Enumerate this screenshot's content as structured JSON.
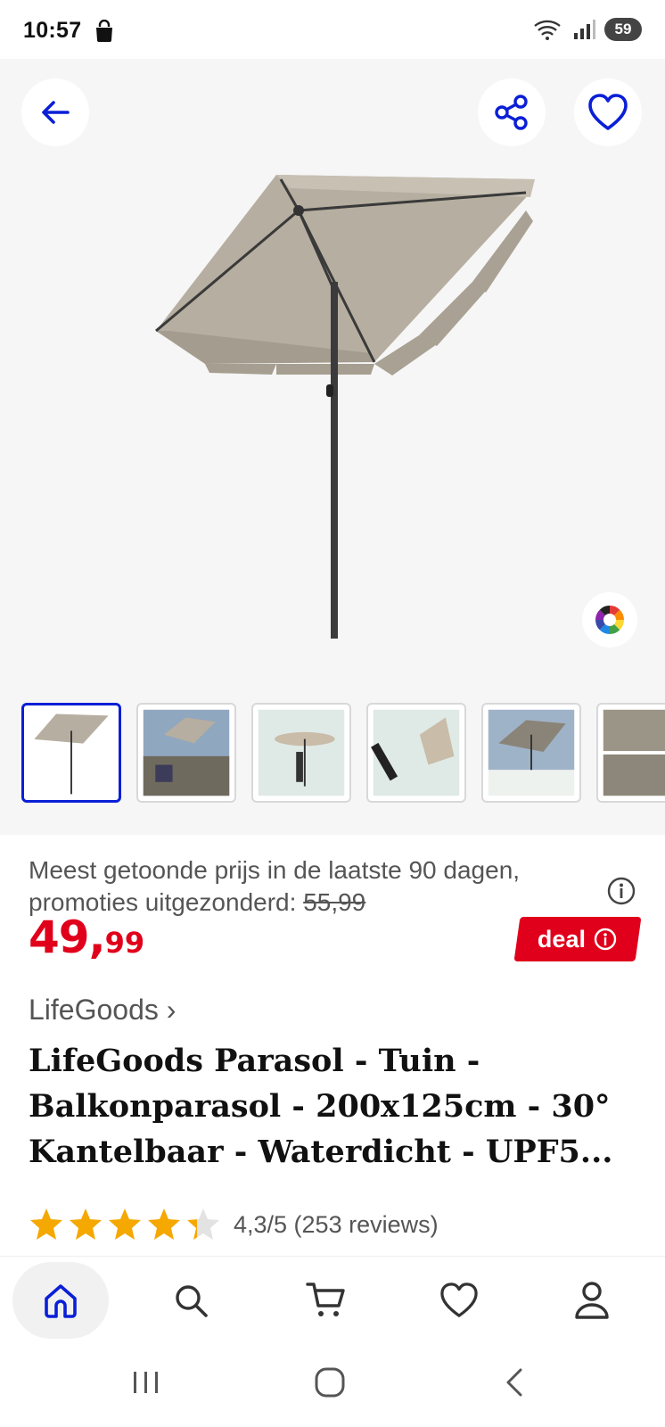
{
  "status_bar": {
    "time": "10:57",
    "battery": "59"
  },
  "gallery": {
    "selected_index": 0,
    "thumbnails": [
      "thumb-1",
      "thumb-2",
      "thumb-3",
      "thumb-4",
      "thumb-5",
      "thumb-6"
    ]
  },
  "product": {
    "price_note": "Meest getoonde prijs in de laatste 90 dagen, promoties uitgezonderd:",
    "old_price": "55,99",
    "price_int": "49,",
    "price_dec": "99",
    "deal_label": "deal",
    "brand": "LifeGoods ›",
    "title": "LifeGoods Parasol - Tuin - Balkonparasol - 200x125cm - 30° Kantelbaar - Waterdicht - UPF5...",
    "rating_value": 4.3,
    "rating_text": "4,3/5 (253 reviews)"
  },
  "colors": {
    "accent_blue": "#0a1fd6",
    "price_red": "#e0001b",
    "star": "#f5a800"
  },
  "icons": [
    "arrow-left-icon",
    "share-icon",
    "heart-icon",
    "color-palette-icon",
    "info-icon",
    "home-icon",
    "search-icon",
    "cart-icon",
    "heart-icon",
    "user-icon"
  ]
}
